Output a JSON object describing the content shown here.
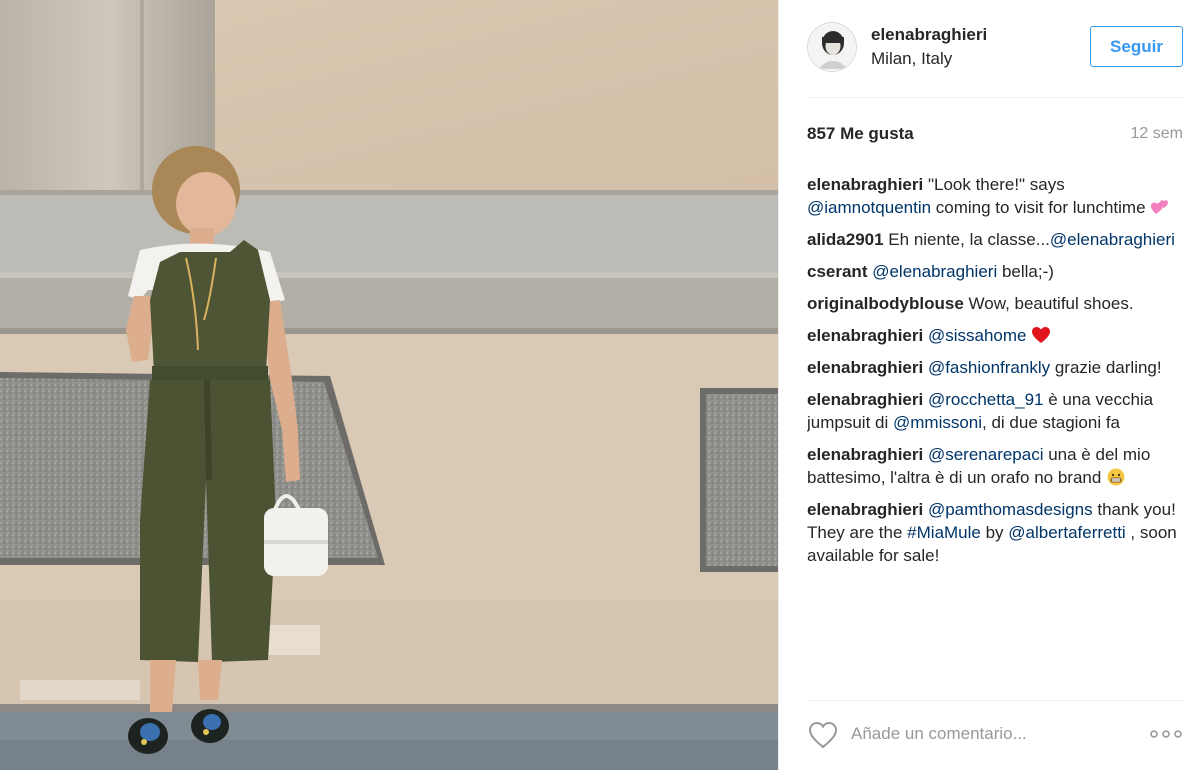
{
  "photo": {
    "description_icon": "photo-image",
    "wall_color": "#dcc9b3",
    "jumpsuit_color": "#4d5535"
  },
  "header": {
    "username": "elenabraghieri",
    "location": "Milan, Italy",
    "follow_label": "Seguir",
    "avatar_icon": "profile-photo"
  },
  "stats": {
    "likes": "857 Me gusta",
    "age": "12 sem"
  },
  "comments": [
    {
      "author": "elenabraghieri",
      "parts": [
        {
          "t": "text",
          "v": "\"Look there!\" says "
        },
        {
          "t": "mention",
          "v": "@iamnotquentin"
        },
        {
          "t": "text",
          "v": " coming to visit for lunchtime "
        },
        {
          "t": "emoji",
          "v": "two-hearts"
        }
      ]
    },
    {
      "author": "alida2901",
      "parts": [
        {
          "t": "text",
          "v": "Eh niente, la classe..."
        },
        {
          "t": "mention",
          "v": "@elenabraghieri"
        }
      ]
    },
    {
      "author": "cserant",
      "parts": [
        {
          "t": "mention",
          "v": "@elenabraghieri"
        },
        {
          "t": "text",
          "v": " bella;-)"
        }
      ]
    },
    {
      "author": "originalbodyblouse",
      "parts": [
        {
          "t": "text",
          "v": "Wow, beautiful shoes."
        }
      ]
    },
    {
      "author": "elenabraghieri",
      "parts": [
        {
          "t": "mention",
          "v": "@sissahome"
        },
        {
          "t": "text",
          "v": " "
        },
        {
          "t": "emoji",
          "v": "red-heart"
        }
      ]
    },
    {
      "author": "elenabraghieri",
      "parts": [
        {
          "t": "mention",
          "v": "@fashionfrankly"
        },
        {
          "t": "text",
          "v": " grazie darling!"
        }
      ]
    },
    {
      "author": "elenabraghieri",
      "parts": [
        {
          "t": "mention",
          "v": "@rocchetta_91"
        },
        {
          "t": "text",
          "v": " è una vecchia jumpsuit di "
        },
        {
          "t": "mention",
          "v": "@mmissoni"
        },
        {
          "t": "text",
          "v": ", di due stagioni fa"
        }
      ]
    },
    {
      "author": "elenabraghieri",
      "parts": [
        {
          "t": "mention",
          "v": "@serenarepaci"
        },
        {
          "t": "text",
          "v": " una è del mio battesimo, l'altra è di un orafo no brand "
        },
        {
          "t": "emoji",
          "v": "grinning-face"
        }
      ]
    },
    {
      "author": "elenabraghieri",
      "parts": [
        {
          "t": "mention",
          "v": "@pamthomasdesigns"
        },
        {
          "t": "text",
          "v": " thank you! They are the "
        },
        {
          "t": "mention",
          "v": "#MiaMule"
        },
        {
          "t": "text",
          "v": " by "
        },
        {
          "t": "mention",
          "v": "@albertaferretti"
        },
        {
          "t": "text",
          "v": " , soon available for sale!"
        }
      ]
    }
  ],
  "footer": {
    "comment_placeholder": "Añade un comentario...",
    "like_icon": "heart-outline-icon",
    "more_icon": "more-options-icon"
  },
  "colors": {
    "accent": "#3897f0",
    "mention": "#003569",
    "muted": "#999999",
    "text": "#262626"
  }
}
